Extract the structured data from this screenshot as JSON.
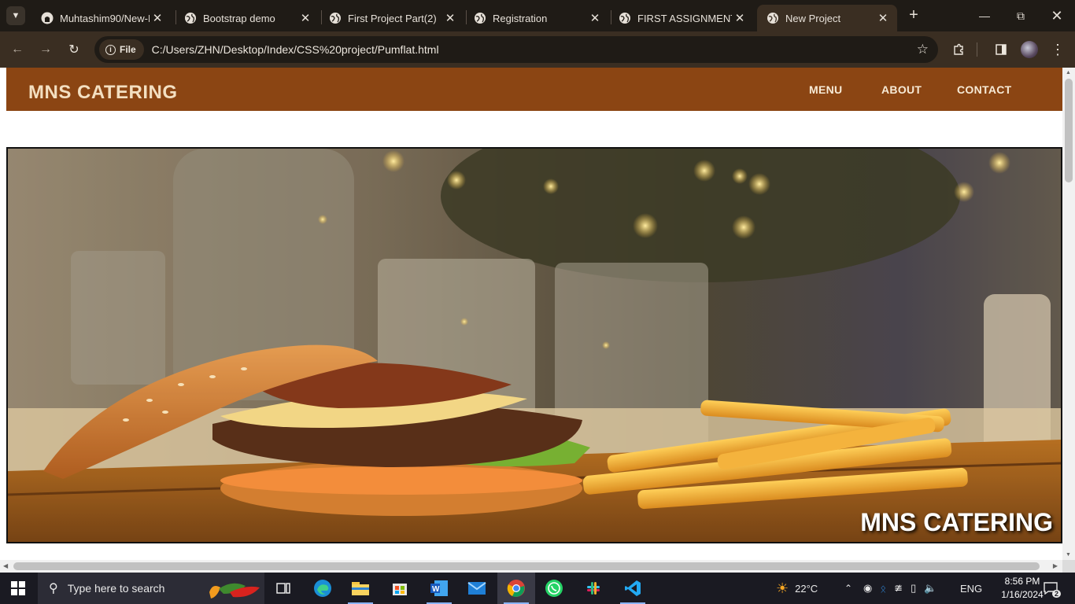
{
  "browser": {
    "tabs": [
      {
        "title": "Muhtashim90/New-P",
        "icon": "github-icon",
        "active": false
      },
      {
        "title": "Bootstrap demo",
        "icon": "globe-icon",
        "active": false
      },
      {
        "title": "First Project Part(2)",
        "icon": "globe-icon",
        "active": false
      },
      {
        "title": "Registration",
        "icon": "globe-icon",
        "active": false
      },
      {
        "title": "FIRST ASSIGNMENT",
        "icon": "globe-icon",
        "active": false
      },
      {
        "title": "New Project",
        "icon": "globe-icon",
        "active": true
      }
    ],
    "new_tab_label": "+",
    "scheme_chip": "File",
    "address": "C:/Users/ZHN/Desktop/Index/CSS%20project/Pumflat.html"
  },
  "site": {
    "brand": "MNS CATERING",
    "nav": [
      "MENU",
      "ABOUT",
      "CONTACT"
    ],
    "hero_caption": "MNS CATERING",
    "colors": {
      "nav_bg": "#8b4513",
      "brand_text": "#f3dfc1"
    }
  },
  "taskbar": {
    "search_placeholder": "Type here to search",
    "weather": "22°C",
    "language": "ENG",
    "time": "8:56 PM",
    "date": "1/16/2024",
    "notifications": "2",
    "apps": [
      "task-view-icon",
      "edge-icon",
      "file-explorer-icon",
      "microsoft-store-icon",
      "word-icon",
      "mail-icon",
      "chrome-icon",
      "whatsapp-icon",
      "slack-icon",
      "vscode-icon"
    ]
  }
}
